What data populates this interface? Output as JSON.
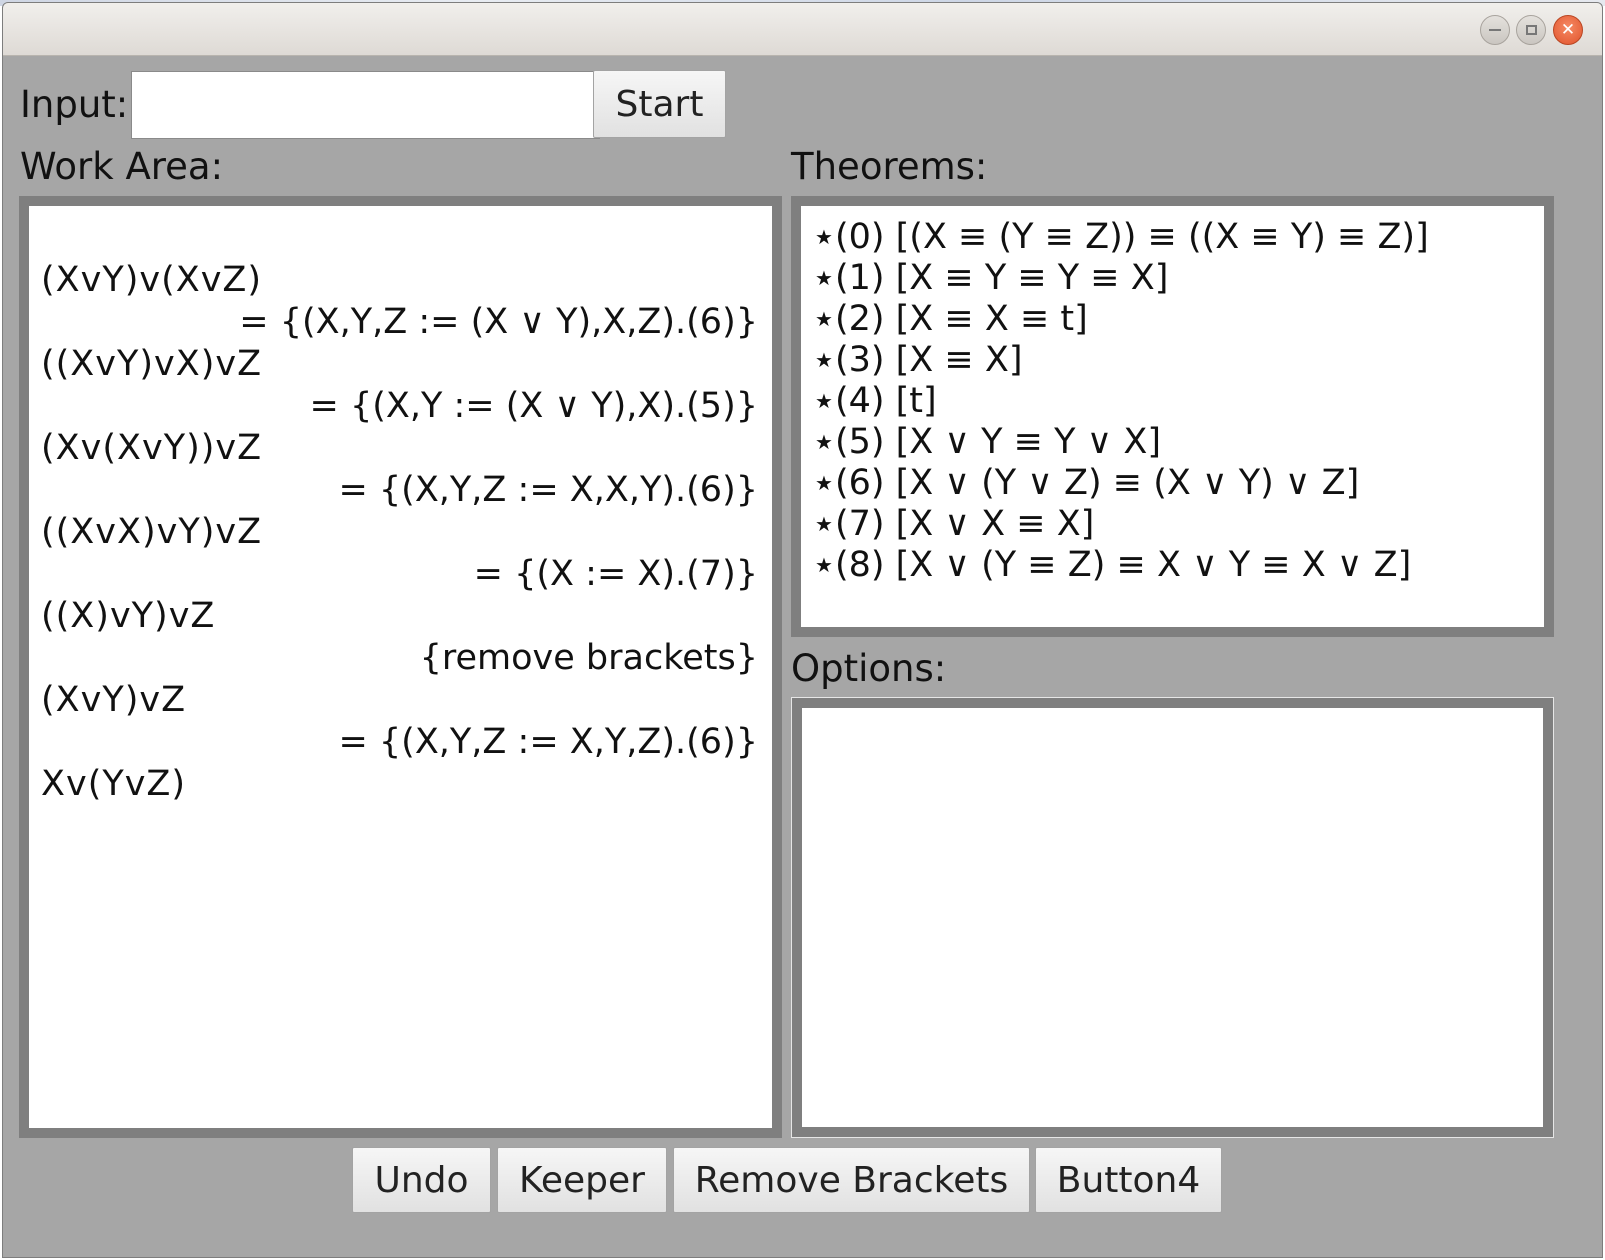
{
  "window": {
    "buttons": [
      "minimize-icon",
      "maximize-icon",
      "close-icon"
    ]
  },
  "input": {
    "label": "Input:",
    "value": "",
    "start_label": "Start"
  },
  "work_area": {
    "label": "Work Area:",
    "lines": [
      {
        "type": "expr",
        "text": "(XvY)v(XvZ)"
      },
      {
        "type": "hint",
        "text": "= {(X,Y,Z := (X ∨ Y),X,Z).(6)}"
      },
      {
        "type": "expr",
        "text": "((XvY)vX)vZ"
      },
      {
        "type": "hint",
        "text": "= {(X,Y := (X ∨ Y),X).(5)}"
      },
      {
        "type": "expr",
        "text": "(Xv(XvY))vZ"
      },
      {
        "type": "hint",
        "text": "= {(X,Y,Z := X,X,Y).(6)}"
      },
      {
        "type": "expr",
        "text": "((XvX)vY)vZ"
      },
      {
        "type": "hint",
        "text": "= {(X := X).(7)}"
      },
      {
        "type": "expr",
        "text": "((X)vY)vZ"
      },
      {
        "type": "hint",
        "text": "{remove brackets}"
      },
      {
        "type": "expr",
        "text": "(XvY)vZ"
      },
      {
        "type": "hint",
        "text": "= {(X,Y,Z := X,Y,Z).(6)}"
      },
      {
        "type": "expr",
        "text": "Xv(YvZ)"
      }
    ]
  },
  "theorems": {
    "label": "Theorems:",
    "marker": "★",
    "items": [
      "(0) [(X ≡ (Y ≡ Z)) ≡ ((X ≡ Y) ≡ Z)]",
      "(1) [X ≡ Y ≡ Y ≡ X]",
      "(2) [X ≡ X ≡ t]",
      "(3) [X ≡ X]",
      "(4) [t]",
      "(5) [X ∨ Y ≡ Y ∨ X]",
      "(6) [X ∨ (Y ∨ Z) ≡ (X ∨ Y) ∨ Z]",
      "(7) [X ∨ X ≡ X]",
      "(8) [X ∨ (Y ≡ Z) ≡ X ∨ Y ≡ X ∨ Z]"
    ]
  },
  "options": {
    "label": "Options:",
    "items": []
  },
  "bottom_buttons": [
    "Undo",
    "Keeper",
    "Remove Brackets",
    "Button4"
  ]
}
